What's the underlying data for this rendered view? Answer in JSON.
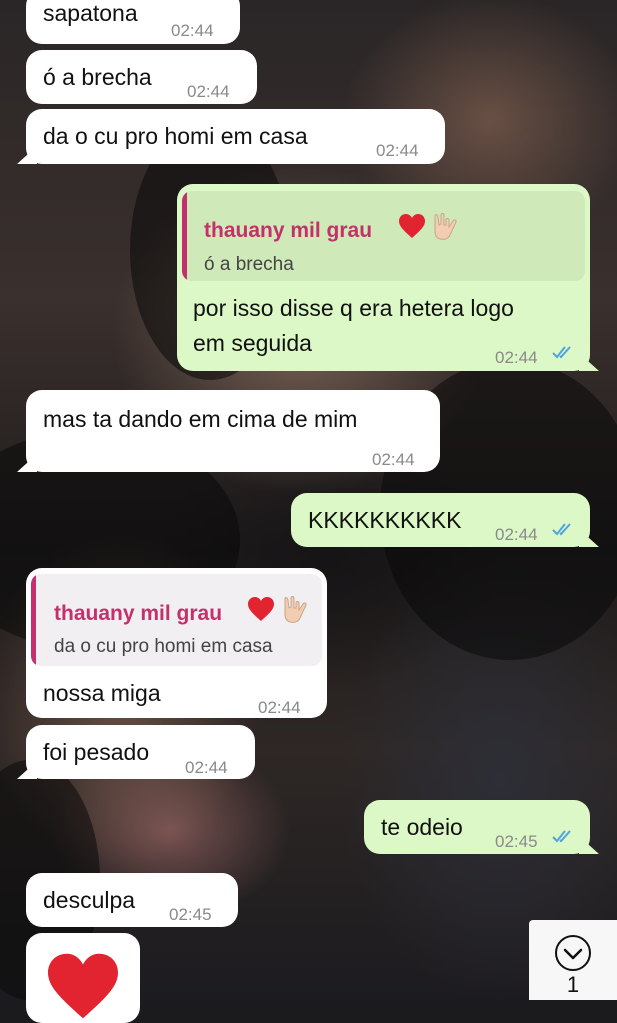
{
  "chat": {
    "messages": [
      {
        "direction": "in",
        "text": "sapatona",
        "time": "02:44"
      },
      {
        "direction": "in",
        "text": "ó a brecha",
        "time": "02:44"
      },
      {
        "direction": "in",
        "text": "da o cu pro homi em casa",
        "time": "02:44"
      },
      {
        "direction": "out",
        "reply_to": {
          "name": "thauany mil grau",
          "text": "ó a brecha"
        },
        "text_line1": "por isso disse q era hetera logo",
        "text_line2": "em seguida",
        "time": "02:44",
        "status": "read"
      },
      {
        "direction": "in",
        "text": "mas ta dando em cima de mim",
        "time": "02:44"
      },
      {
        "direction": "out",
        "text": "KKKKKKKKKK",
        "time": "02:44",
        "status": "read"
      },
      {
        "direction": "in",
        "reply_to": {
          "name": "thauany mil grau",
          "text": "da o cu pro homi em casa"
        },
        "text": "nossa miga",
        "time": "02:44"
      },
      {
        "direction": "in",
        "text": "foi pesado",
        "time": "02:44"
      },
      {
        "direction": "out",
        "text": "te odeio",
        "time": "02:45",
        "status": "read"
      },
      {
        "direction": "in",
        "text": "desculpa",
        "time": "02:45"
      },
      {
        "direction": "in",
        "emoji": "red-heart"
      }
    ]
  },
  "scroll_down": {
    "icon": "chevron-down-icon",
    "unread_count": "1"
  },
  "colors": {
    "incoming_bubble": "#ffffff",
    "outgoing_bubble": "#dcf8c6",
    "quote_name": "#c4306b",
    "read_ticks": "#4fa3e0",
    "timestamp": "#8a8a8a"
  }
}
